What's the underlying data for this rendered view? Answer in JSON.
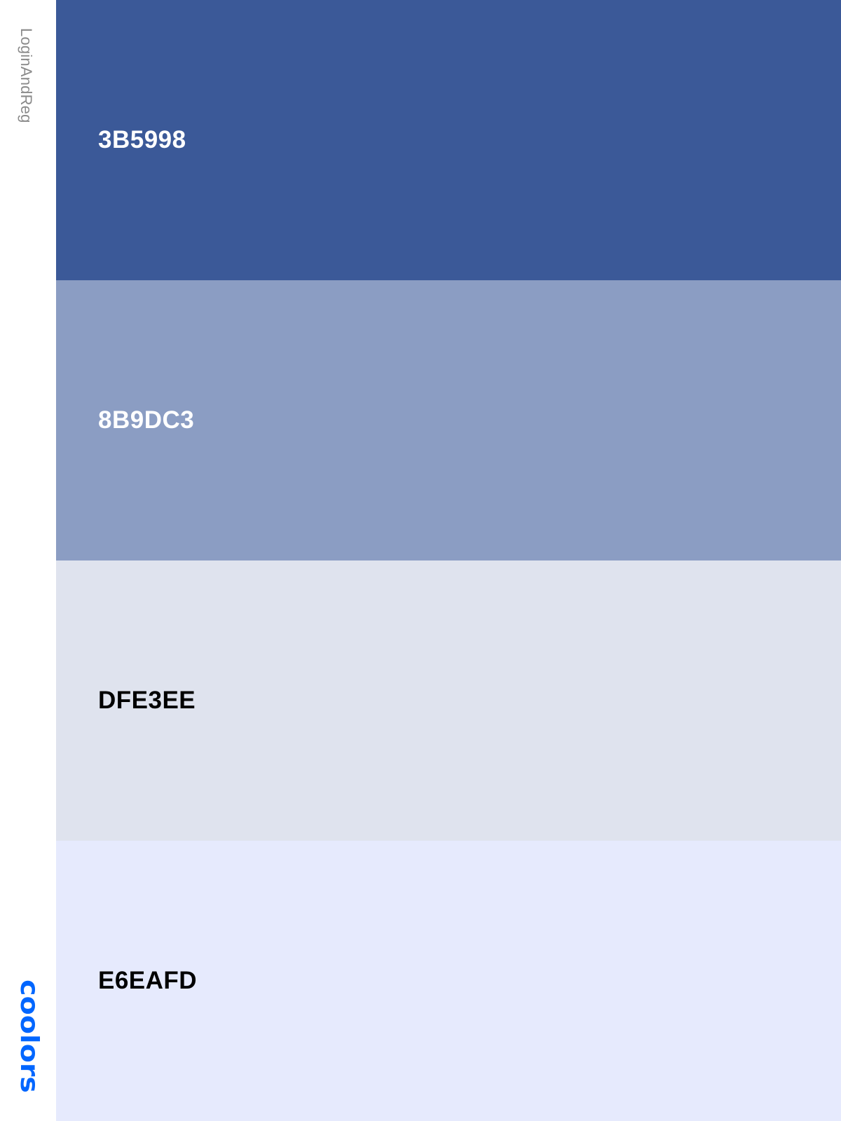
{
  "palette": {
    "name": "LoginAndReg"
  },
  "brand": {
    "logo_text": "coolors",
    "logo_color": "#0066ff"
  },
  "swatches": [
    {
      "hex": "3B5998",
      "color": "#3B5998",
      "text_color": "#ffffff"
    },
    {
      "hex": "8B9DC3",
      "color": "#8B9DC3",
      "text_color": "#ffffff"
    },
    {
      "hex": "DFE3EE",
      "color": "#DFE3EE",
      "text_color": "#000000"
    },
    {
      "hex": "E6EAFD",
      "color": "#E6EAFD",
      "text_color": "#000000"
    }
  ]
}
